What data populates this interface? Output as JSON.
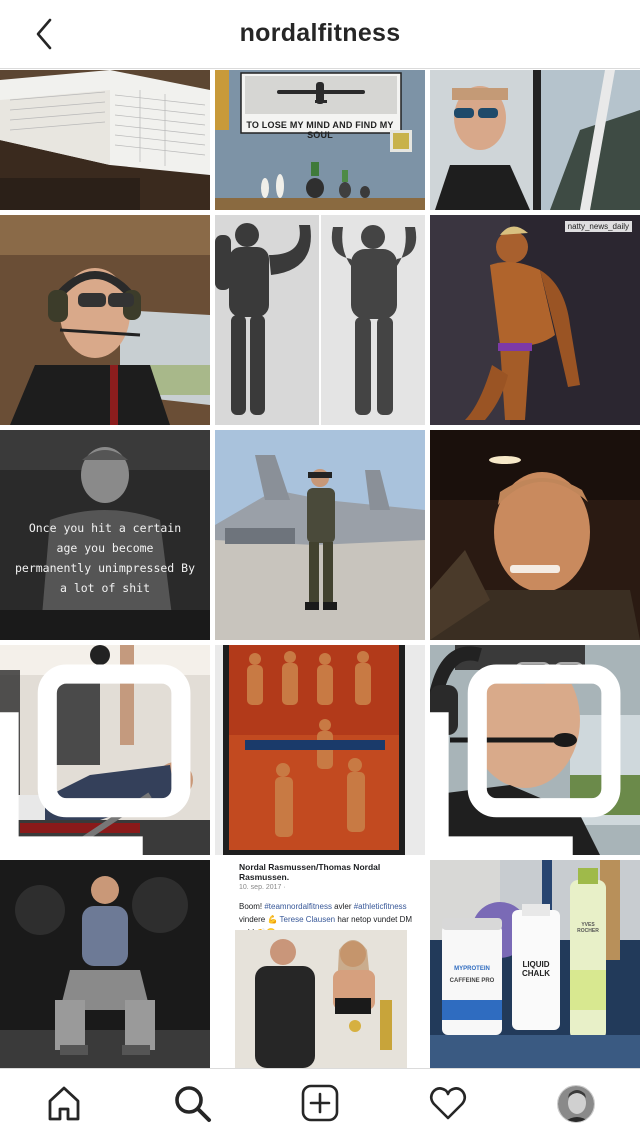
{
  "header": {
    "title": "nordalfitness",
    "back_icon": "chevron-left-icon"
  },
  "grid": {
    "posts": [
      {
        "id": "flight-logbook"
      },
      {
        "id": "plane-poster",
        "poster_text": "TO LOSE MY MIND AND FIND MY SOUL"
      },
      {
        "id": "cockpit-selfie"
      },
      {
        "id": "pilot-headset"
      },
      {
        "id": "bodybuilding-poses"
      },
      {
        "id": "bronze-physique",
        "watermark": "natty_news_daily"
      },
      {
        "id": "quote-portrait",
        "caption": "Once you hit a certain\nage you become\npermanently unimpressed By\na lot of shit"
      },
      {
        "id": "fighter-jet-pilot"
      },
      {
        "id": "car-selfie"
      },
      {
        "id": "gym-bench-press"
      },
      {
        "id": "framed-competition-photos"
      },
      {
        "id": "pilot-sunglasses"
      },
      {
        "id": "gym-squat-pose"
      },
      {
        "id": "facebook-post",
        "post_name": "Nordal Rasmussen/Thomas Nordal Rasmussen.",
        "post_date": "10. sep. 2017 · ",
        "post_text_1": "Boom! ",
        "post_tag_1": "#teamnordalfitness",
        "post_text_2": " avler ",
        "post_tag_2": "#athleticfitness",
        "post_text_3": " vindere 💪 ",
        "post_tag_3": "Terese Clausen",
        "post_text_4": " har netop vundet DM guld 👏😀"
      },
      {
        "id": "supplements",
        "label_1": "MYPROTEIN",
        "label_2": "CAFFEINE PRO",
        "label_3": "LIQUID CHALK",
        "label_4": "YVES ROCHER"
      }
    ]
  },
  "tabbar": {
    "home_icon": "home-icon",
    "search_icon": "search-icon",
    "add_icon": "add-post-icon",
    "activity_icon": "heart-icon",
    "profile_icon": "avatar"
  },
  "colors": {
    "text": "#262626",
    "border": "#dbdbdb",
    "link": "#385898"
  }
}
